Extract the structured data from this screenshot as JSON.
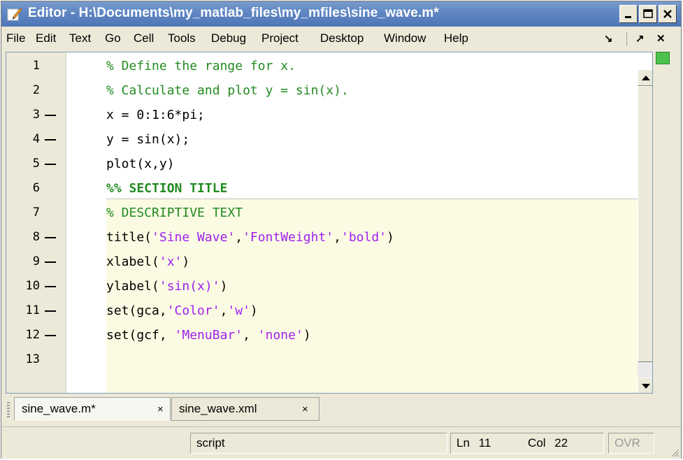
{
  "window": {
    "title": "Editor - H:\\Documents\\my_matlab_files\\my_mfiles\\sine_wave.m*"
  },
  "menubar": {
    "items": [
      "File",
      "Edit",
      "Text",
      "Go",
      "Cell",
      "Tools",
      "Debug",
      "Project",
      "Desktop",
      "Window",
      "Help"
    ],
    "right_glyphs": [
      "↘",
      "↗",
      "✕"
    ]
  },
  "editor": {
    "lines": [
      {
        "number": "1",
        "executable": false,
        "tokens": [
          {
            "t": "% Define the range for x.",
            "k": "comment"
          }
        ]
      },
      {
        "number": "2",
        "executable": false,
        "tokens": [
          {
            "t": "% Calculate and plot y = sin(x).",
            "k": "comment"
          }
        ]
      },
      {
        "number": "3",
        "executable": true,
        "tokens": [
          {
            "t": "x = 0:1:6*pi;",
            "k": "code"
          }
        ]
      },
      {
        "number": "4",
        "executable": true,
        "tokens": [
          {
            "t": "y = sin(x);",
            "k": "code"
          }
        ]
      },
      {
        "number": "5",
        "executable": true,
        "tokens": [
          {
            "t": "plot(x,y)",
            "k": "code"
          }
        ]
      },
      {
        "number": "6",
        "executable": false,
        "tokens": [
          {
            "t": "%% SECTION TITLE",
            "k": "cellhead"
          }
        ]
      },
      {
        "number": "7",
        "executable": false,
        "tokens": [
          {
            "t": "% DESCRIPTIVE TEXT",
            "k": "comment"
          }
        ]
      },
      {
        "number": "8",
        "executable": true,
        "tokens": [
          {
            "t": "title(",
            "k": "code"
          },
          {
            "t": "'Sine Wave'",
            "k": "string"
          },
          {
            "t": ",",
            "k": "code"
          },
          {
            "t": "'FontWeight'",
            "k": "string"
          },
          {
            "t": ",",
            "k": "code"
          },
          {
            "t": "'bold'",
            "k": "string"
          },
          {
            "t": ")",
            "k": "code"
          }
        ]
      },
      {
        "number": "9",
        "executable": true,
        "tokens": [
          {
            "t": "xlabel(",
            "k": "code"
          },
          {
            "t": "'x'",
            "k": "string"
          },
          {
            "t": ")",
            "k": "code"
          }
        ]
      },
      {
        "number": "10",
        "executable": true,
        "tokens": [
          {
            "t": "ylabel(",
            "k": "code"
          },
          {
            "t": "'sin(x)'",
            "k": "string"
          },
          {
            "t": ")",
            "k": "code"
          }
        ]
      },
      {
        "number": "11",
        "executable": true,
        "tokens": [
          {
            "t": "set(gca,",
            "k": "code"
          },
          {
            "t": "'Color'",
            "k": "string"
          },
          {
            "t": ",",
            "k": "code"
          },
          {
            "t": "'w'",
            "k": "string"
          },
          {
            "t": ")",
            "k": "code"
          }
        ]
      },
      {
        "number": "12",
        "executable": true,
        "tokens": [
          {
            "t": "set(gcf, ",
            "k": "code"
          },
          {
            "t": "'MenuBar'",
            "k": "string"
          },
          {
            "t": ", ",
            "k": "code"
          },
          {
            "t": "'none'",
            "k": "string"
          },
          {
            "t": ")",
            "k": "code"
          }
        ]
      },
      {
        "number": "13",
        "executable": false,
        "tokens": []
      }
    ],
    "colors": {
      "comment": "#228b22",
      "string": "#a020f0",
      "cell_background": "#fbfbe3",
      "analyzer_status": "#4cc24c"
    }
  },
  "tabs": [
    {
      "label": "sine_wave.m*",
      "close": "×",
      "active": true
    },
    {
      "label": "sine_wave.xml",
      "close": "×",
      "active": false
    }
  ],
  "statusbar": {
    "mode": "script",
    "ln_label": "Ln",
    "ln_value": "11",
    "col_label": "Col",
    "col_value": "22",
    "ovr": "OVR"
  }
}
